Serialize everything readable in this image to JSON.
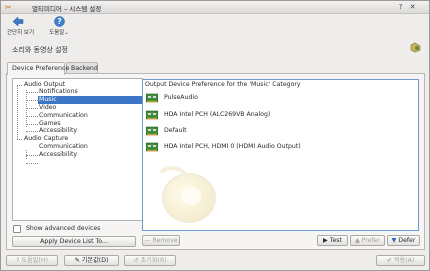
{
  "window": {
    "title": "멀티미디어 – 시스템 설정"
  },
  "toolbar": {
    "overview_label": "간단히 보기",
    "help_label": "도움말"
  },
  "header": {
    "title": "소리와 동영상 설정"
  },
  "tabs": [
    {
      "label": "Device Preference"
    },
    {
      "label": "Backend"
    }
  ],
  "tree": {
    "audio_output": "Audio Output",
    "notifications": "Notifications",
    "music": "Music",
    "video": "Video",
    "communication": "Communication",
    "games": "Games",
    "accessibility": "Accessibility",
    "audio_capture": "Audio Capture",
    "capture_communication": "Communication",
    "capture_accessibility": "Accessibility"
  },
  "show_advanced": {
    "label": "Show advanced devices",
    "checked": false
  },
  "apply_button": "Apply Device List To...",
  "panel": {
    "title": "Output Device Preference for the 'Music' Category",
    "devices": [
      "PulseAudio",
      "HDA Intel PCH (ALC269VB Analog)",
      "Default",
      "HDA Intel PCH, HDMI 0 (HDMI Audio Output)"
    ]
  },
  "buttons": {
    "remove": "Remove",
    "test": "Test",
    "prefer": "Prefer",
    "defer": "Defer"
  },
  "bottom": {
    "help": "도움말(H)",
    "defaults": "기본값(D)",
    "reset": "초기화(R)",
    "apply": "적용(A)"
  }
}
